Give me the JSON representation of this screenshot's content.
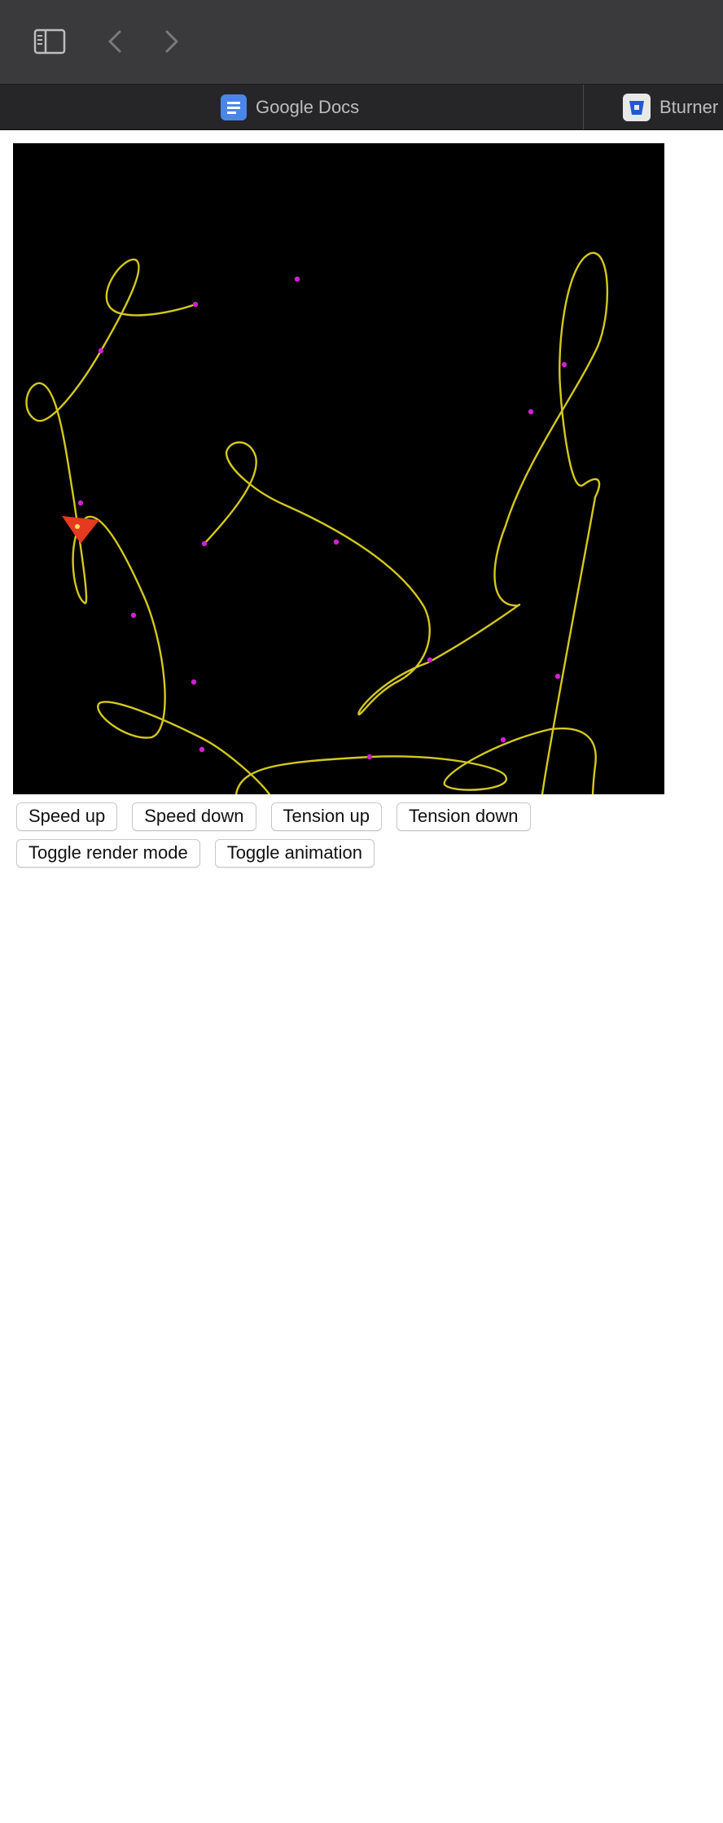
{
  "browser": {
    "toolbar": {
      "sidebar_icon": "sidebar-icon",
      "back_icon": "chevron-left-icon",
      "forward_icon": "chevron-right-icon"
    },
    "tabs": [
      {
        "label": "Google Docs",
        "icon": "google-docs-icon",
        "icon_color": "#4a86e8"
      },
      {
        "label": "Bturner",
        "icon": "bitbucket-icon",
        "icon_color": "#2159d4"
      }
    ]
  },
  "canvas": {
    "background": "#000000",
    "curve_color": "#d4c81e",
    "point_color": "#d020d0",
    "pointer_color": "#e53a20"
  },
  "controls": {
    "speed_up": "Speed up",
    "speed_down": "Speed down",
    "tension_up": "Tension up",
    "tension_down": "Tension down",
    "toggle_render_mode": "Toggle render mode",
    "toggle_animation": "Toggle animation"
  }
}
